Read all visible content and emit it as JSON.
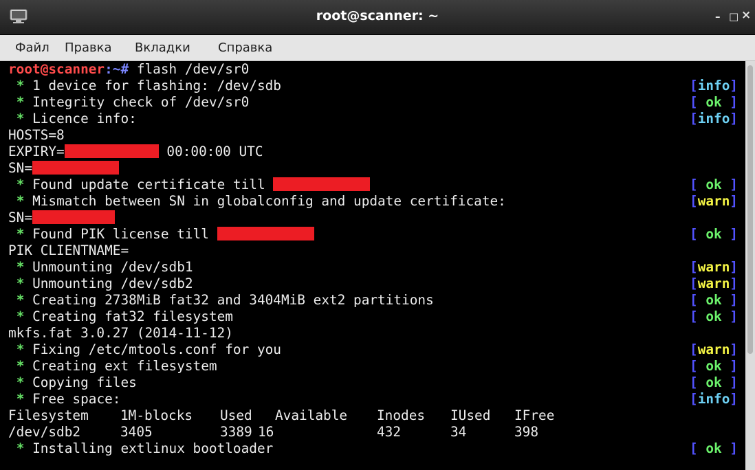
{
  "window": {
    "title": "root@scanner: ~",
    "minimize": "–",
    "maximize": "□",
    "close": "×"
  },
  "menu": [
    "Файл",
    "Правка",
    "Вкладки",
    "Справка"
  ],
  "prompt": {
    "user_host": "root@scanner",
    "path": ":~",
    "symbol": "# ",
    "command": "flash /dev/sr0"
  },
  "lines": [
    {
      "text": "1 device for flashing: /dev/sdb",
      "status": "info"
    },
    {
      "text": "Integrity check of /dev/sr0",
      "status": "ok"
    },
    {
      "text": "Licence info:",
      "status": "info"
    },
    {
      "text": "HOSTS=8"
    },
    {
      "text": "EXPIRY=",
      "after": " 00:00:00 UTC"
    },
    {
      "text": "SN="
    },
    {
      "text": "Found update certificate till ",
      "status": "ok"
    },
    {
      "text": "Mismatch between SN in globalconfig and update certificate:",
      "status": "warn"
    },
    {
      "text": "SN="
    },
    {
      "text": "Found PIK license till ",
      "status": "ok"
    },
    {
      "text": "PIK CLIENTNAME="
    },
    {
      "text": "Unmounting /dev/sdb1",
      "status": "warn"
    },
    {
      "text": "Unmounting /dev/sdb2",
      "status": "warn"
    },
    {
      "text": "Creating 2738MiB fat32 and 3404MiB ext2 partitions",
      "status": "ok"
    },
    {
      "text": "Creating fat32 filesystem",
      "status": "ok"
    },
    {
      "text": "mkfs.fat 3.0.27 (2014-11-12)"
    },
    {
      "text": "Fixing /etc/mtools.conf for you",
      "status": "warn"
    },
    {
      "text": "Creating ext filesystem",
      "status": "ok"
    },
    {
      "text": "Copying files",
      "status": "ok"
    },
    {
      "text": "Free space:",
      "status": "info"
    },
    {
      "text": "Installing extlinux bootloader",
      "status": "ok"
    }
  ],
  "df_table": {
    "headers": [
      "Filesystem",
      "1M-blocks",
      "Used",
      "Available",
      "Inodes",
      "IUsed",
      "IFree"
    ],
    "row": [
      "/dev/sdb2",
      "3405",
      "3389",
      "16",
      "432",
      "34",
      "398"
    ]
  },
  "status_labels": {
    "info": "info",
    "ok": " ok ",
    "warn": "warn"
  },
  "colors": {
    "background": "#000000",
    "prompt_user": "#ff4b4b",
    "prompt_path": "#7b86ff",
    "bullet": "#66e066",
    "bracket": "#5252ff",
    "info": "#6ed1f5",
    "ok": "#6cf36c",
    "warn": "#f5f545",
    "redaction": "#ec1d24"
  }
}
